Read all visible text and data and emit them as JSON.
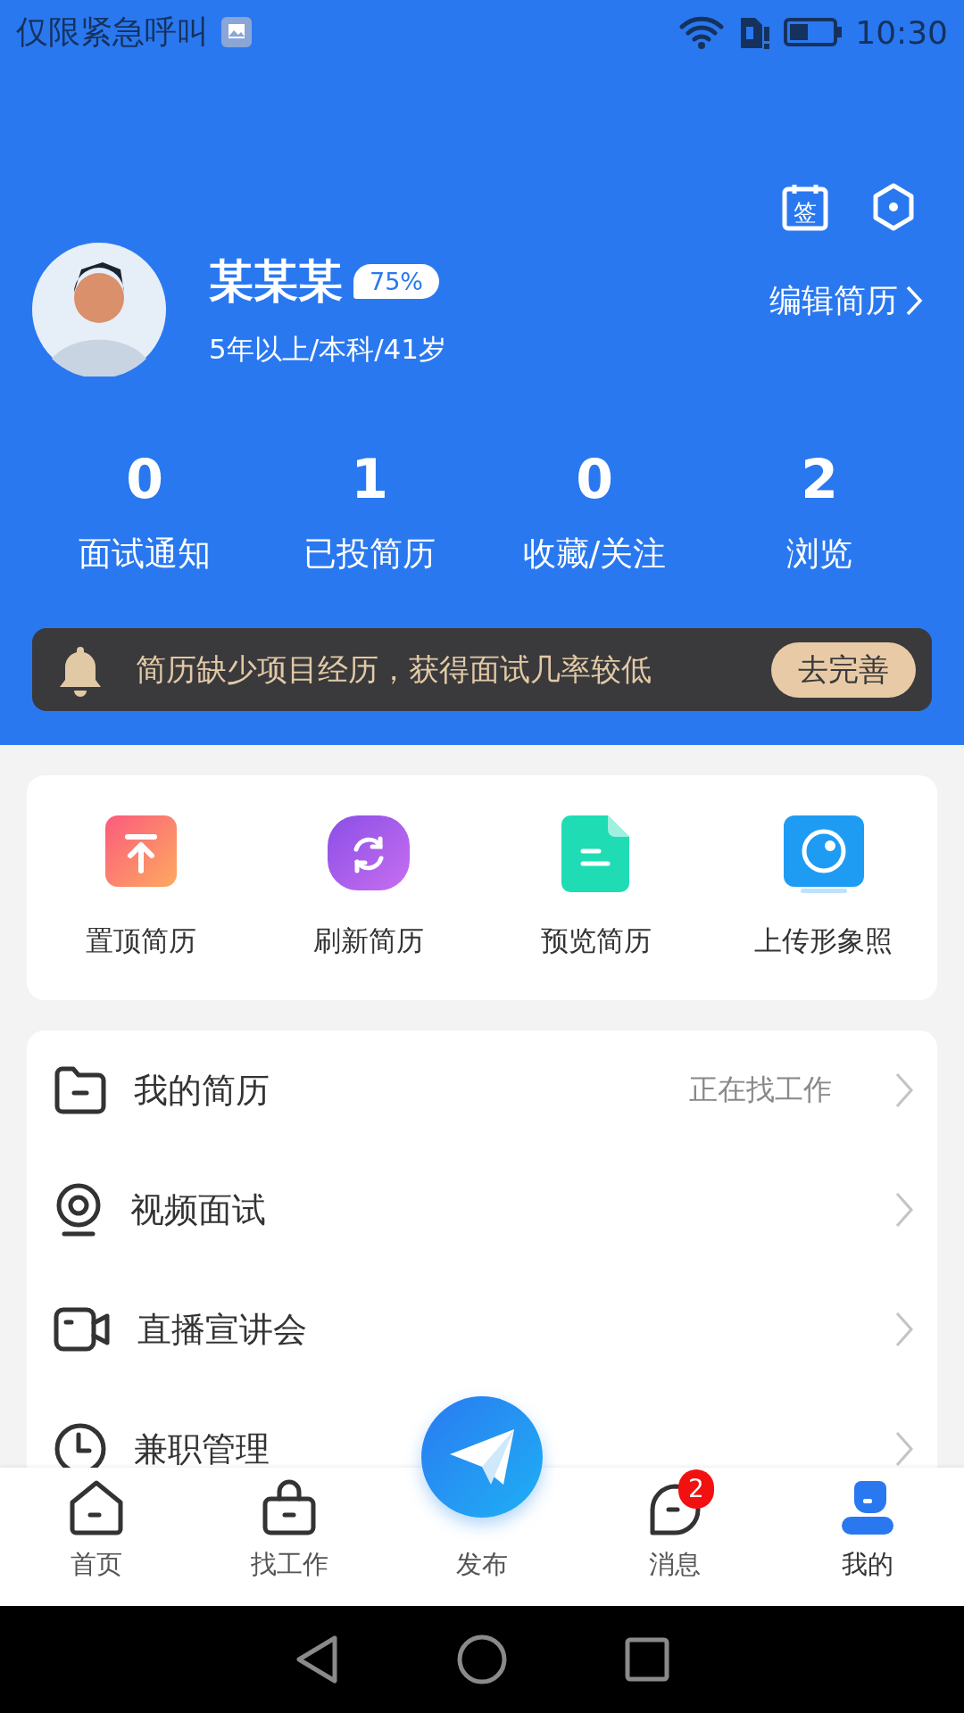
{
  "status_bar": {
    "carrier": "仅限紧急呼叫",
    "time": "10:30"
  },
  "header": {
    "sign_label": "签",
    "name": "某某某",
    "completeness": "75%",
    "summary": "5年以上/本科/41岁",
    "edit_link": "编辑简历"
  },
  "stats": [
    {
      "value": "0",
      "label": "面试通知"
    },
    {
      "value": "1",
      "label": "已投简历"
    },
    {
      "value": "0",
      "label": "收藏/关注"
    },
    {
      "value": "2",
      "label": "浏览"
    }
  ],
  "notice": {
    "text": "简历缺少项目经历，获得面试几率较低",
    "button": "去完善"
  },
  "quick_actions": [
    {
      "kind": "top",
      "label": "置顶简历"
    },
    {
      "kind": "refresh",
      "label": "刷新简历"
    },
    {
      "kind": "preview",
      "label": "预览简历"
    },
    {
      "kind": "photo",
      "label": "上传形象照"
    }
  ],
  "menu": [
    {
      "kind": "folder",
      "label": "我的简历",
      "value": "正在找工作"
    },
    {
      "kind": "webcam",
      "label": "视频面试"
    },
    {
      "kind": "video",
      "label": "直播宣讲会"
    },
    {
      "kind": "clock",
      "label": "兼职管理"
    }
  ],
  "bottom_nav": [
    {
      "kind": "home",
      "label": "首页",
      "selected": false
    },
    {
      "kind": "bag",
      "label": "找工作",
      "selected": false
    },
    {
      "kind": "publish",
      "label": "发布",
      "selected": false
    },
    {
      "kind": "chat",
      "label": "消息",
      "selected": false,
      "badge": "2"
    },
    {
      "kind": "user",
      "label": "我的",
      "selected": true
    }
  ]
}
